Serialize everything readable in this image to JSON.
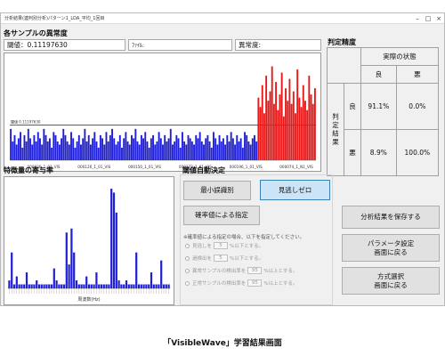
{
  "window": {
    "title": "分析結果(連判別分析)パターン1_LDA_平均_1回目",
    "buttons": [
      "–",
      "□",
      "×"
    ]
  },
  "anomaly": {
    "heading": "各サンプルの異常度",
    "threshold_label": "閾値：",
    "threshold_value": "0.11197630",
    "file_label": "ﾌｧｲﾙ:",
    "file_value": "",
    "degree_label": "異常度:",
    "degree_value": "",
    "threshold_marker": "閾値 0.11197630",
    "x_ticks": [
      "000026_1_01_VIS",
      "000126_1_01_VIS",
      "000150_1_01_VIS",
      "000172_1_01_VIS",
      "000196_1_01_VIS",
      "000074_1_N1_VIS"
    ]
  },
  "accuracy": {
    "heading": "判定精度",
    "actual_header": "実際の状態",
    "good": "良",
    "bad": "悪",
    "judge_label": "判定結果",
    "row_good": "良",
    "row_bad": "悪",
    "cells": {
      "good_good": "91.1%",
      "good_bad": "0.0%",
      "bad_good": "8.9%",
      "bad_bad": "100.0%"
    }
  },
  "features": {
    "heading": "特徴量の寄与率",
    "xlabel": "周波数(Hz)"
  },
  "threshold_auto": {
    "heading": "閾値自動決定",
    "min_error_btn": "最小誤識別",
    "miss_zero_btn": "見逃しゼロ",
    "prob_btn": "確率値による指定",
    "note": "※確率値による指定の場合、以下を指定してください。",
    "options": [
      {
        "pre": "見逃しを",
        "value": "5",
        "post": "%以下とする。"
      },
      {
        "pre": "過検出を",
        "value": "5",
        "post": "%以下とする。"
      },
      {
        "pre": "異常サンプルの検出率を",
        "value": "95",
        "post": "%以上とする。"
      },
      {
        "pre": "正常サンプルの検出率を",
        "value": "95",
        "post": "%以上とする。"
      }
    ]
  },
  "actions": {
    "save": "分析結果を保存する",
    "param_1": "パラメータ設定",
    "param_2": "画面に戻る",
    "method_1": "方式選択",
    "method_2": "画面に戻る"
  },
  "caption": "「VisibleWave」学習結果画面",
  "colors": {
    "normal_bar": "#1f1fd6",
    "anomaly_bar": "#e81818",
    "feature_bar": "#1f1fd6"
  },
  "chart_data": [
    {
      "type": "bar",
      "title": "各サンプルの異常度",
      "threshold": 0.1119763,
      "normal_values": [
        0.1,
        0.06,
        0.08,
        0.05,
        0.07,
        0.09,
        0.04,
        0.08,
        0.06,
        0.1,
        0.07,
        0.05,
        0.08,
        0.06,
        0.09,
        0.07,
        0.05,
        0.1,
        0.08,
        0.06,
        0.07,
        0.04,
        0.09,
        0.08,
        0.06,
        0.05,
        0.07,
        0.1,
        0.08,
        0.06,
        0.05,
        0.09,
        0.07,
        0.04,
        0.06,
        0.08,
        0.05,
        0.07,
        0.1,
        0.06,
        0.08,
        0.05,
        0.07,
        0.09,
        0.06,
        0.04,
        0.08,
        0.07,
        0.05,
        0.09,
        0.06,
        0.08,
        0.1,
        0.07,
        0.05,
        0.06,
        0.08,
        0.04,
        0.07,
        0.09,
        0.06,
        0.05,
        0.08,
        0.07,
        0.1,
        0.06,
        0.05,
        0.08,
        0.07,
        0.09,
        0.06,
        0.04,
        0.07,
        0.08,
        0.05,
        0.06,
        0.09,
        0.07,
        0.05,
        0.08,
        0.06,
        0.07,
        0.1,
        0.05,
        0.06,
        0.08,
        0.07,
        0.04,
        0.09,
        0.06,
        0.05,
        0.08,
        0.07,
        0.06,
        0.05,
        0.08,
        0.07,
        0.09,
        0.06,
        0.05,
        0.07,
        0.08,
        0.06,
        0.04,
        0.09,
        0.07,
        0.05,
        0.08,
        0.06,
        0.07,
        0.05,
        0.08,
        0.06,
        0.09,
        0.07,
        0.05,
        0.08,
        0.06,
        0.07,
        0.04,
        0.09,
        0.08,
        0.06,
        0.05,
        0.07,
        0.08,
        0.06
      ],
      "anomaly_values": [
        0.2,
        0.17,
        0.24,
        0.15,
        0.27,
        0.19,
        0.22,
        0.3,
        0.18,
        0.25,
        0.16,
        0.21,
        0.28,
        0.14,
        0.23,
        0.19,
        0.26,
        0.18,
        0.22,
        0.15,
        0.29,
        0.2,
        0.17,
        0.24,
        0.19,
        0.16,
        0.27,
        0.21,
        0.18,
        0.23
      ],
      "ylim": [
        0,
        0.33
      ]
    },
    {
      "type": "bar",
      "title": "特徴量の寄与率",
      "xlabel": "周波数(Hz)",
      "values": [
        2,
        9,
        1,
        3,
        1,
        1,
        1,
        4,
        1,
        1,
        1,
        2,
        1,
        1,
        1,
        1,
        1,
        1,
        5,
        2,
        1,
        1,
        1,
        14,
        6,
        15,
        9,
        2,
        1,
        1,
        1,
        3,
        1,
        1,
        1,
        4,
        1,
        1,
        1,
        1,
        1,
        25,
        24,
        19,
        2,
        1,
        1,
        2,
        1,
        1,
        1,
        9,
        1,
        1,
        1,
        1,
        1,
        4,
        1,
        1,
        1,
        7,
        1,
        1,
        1
      ],
      "ylim": [
        0,
        27
      ]
    }
  ]
}
